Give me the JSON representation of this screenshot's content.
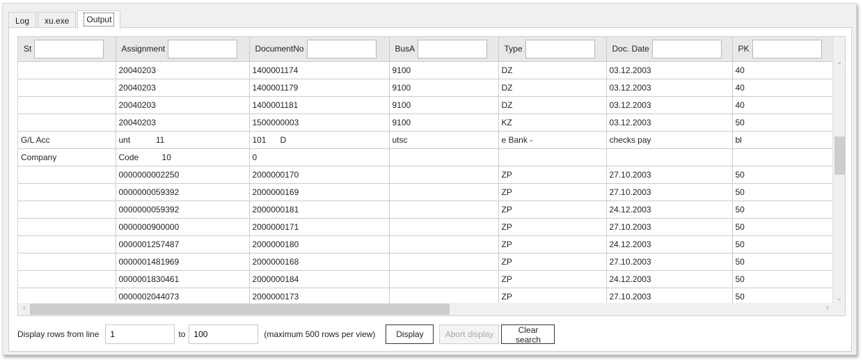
{
  "tabs": [
    {
      "label": "Log",
      "active": false
    },
    {
      "label": "xu.exe",
      "active": false
    },
    {
      "label": "Output",
      "active": true
    }
  ],
  "grid": {
    "columns": [
      {
        "label": "St",
        "filter": ""
      },
      {
        "label": "Assignment",
        "filter": ""
      },
      {
        "label": "DocumentNo",
        "filter": ""
      },
      {
        "label": "BusA",
        "filter": ""
      },
      {
        "label": "Type",
        "filter": ""
      },
      {
        "label": "Doc. Date",
        "filter": ""
      },
      {
        "label": "PK",
        "filter": ""
      }
    ],
    "rows": [
      [
        "",
        "20040203",
        "1400001174",
        "9100",
        "DZ",
        "03.12.2003",
        "40"
      ],
      [
        "",
        "20040203",
        "1400001179",
        "9100",
        "DZ",
        "03.12.2003",
        "40"
      ],
      [
        "",
        "20040203",
        "1400001181",
        "9100",
        "DZ",
        "03.12.2003",
        "40"
      ],
      [
        "",
        "20040203",
        "1500000003",
        "9100",
        "KZ",
        "03.12.2003",
        "50"
      ],
      [
        "G/L Acc",
        "unt           11",
        "101      D",
        "utsc",
        "e Bank -",
        "checks pay",
        "bl"
      ],
      [
        "Company",
        "Code          10",
        "0",
        "",
        "",
        "",
        ""
      ],
      [
        "",
        "0000000002250",
        "2000000170",
        "",
        "ZP",
        "27.10.2003",
        "50"
      ],
      [
        "",
        "0000000059392",
        "2000000169",
        "",
        "ZP",
        "27.10.2003",
        "50"
      ],
      [
        "",
        "0000000059392",
        "2000000181",
        "",
        "ZP",
        "24.12.2003",
        "50"
      ],
      [
        "",
        "0000000900000",
        "2000000171",
        "",
        "ZP",
        "27.10.2003",
        "50"
      ],
      [
        "",
        "0000001257487",
        "2000000180",
        "",
        "ZP",
        "24.12.2003",
        "50"
      ],
      [
        "",
        "0000001481969",
        "2000000168",
        "",
        "ZP",
        "27.10.2003",
        "50"
      ],
      [
        "",
        "0000001830461",
        "2000000184",
        "",
        "ZP",
        "24.12.2003",
        "50"
      ],
      [
        "",
        "0000002044073",
        "2000000173",
        "",
        "ZP",
        "27.10.2003",
        "50"
      ]
    ],
    "icons": {
      "scroll_up": "chevron-up-icon",
      "scroll_down": "chevron-down-icon",
      "scroll_left": "chevron-left-icon",
      "scroll_right": "chevron-right-icon"
    }
  },
  "footer": {
    "from_label": "Display rows from line",
    "from_value": "1",
    "to_label": "to",
    "to_value": "100",
    "hint": "(maximum 500 rows per view)",
    "display_button": "Display",
    "abort_button": "Abort display",
    "clear_button": "Clear search"
  }
}
